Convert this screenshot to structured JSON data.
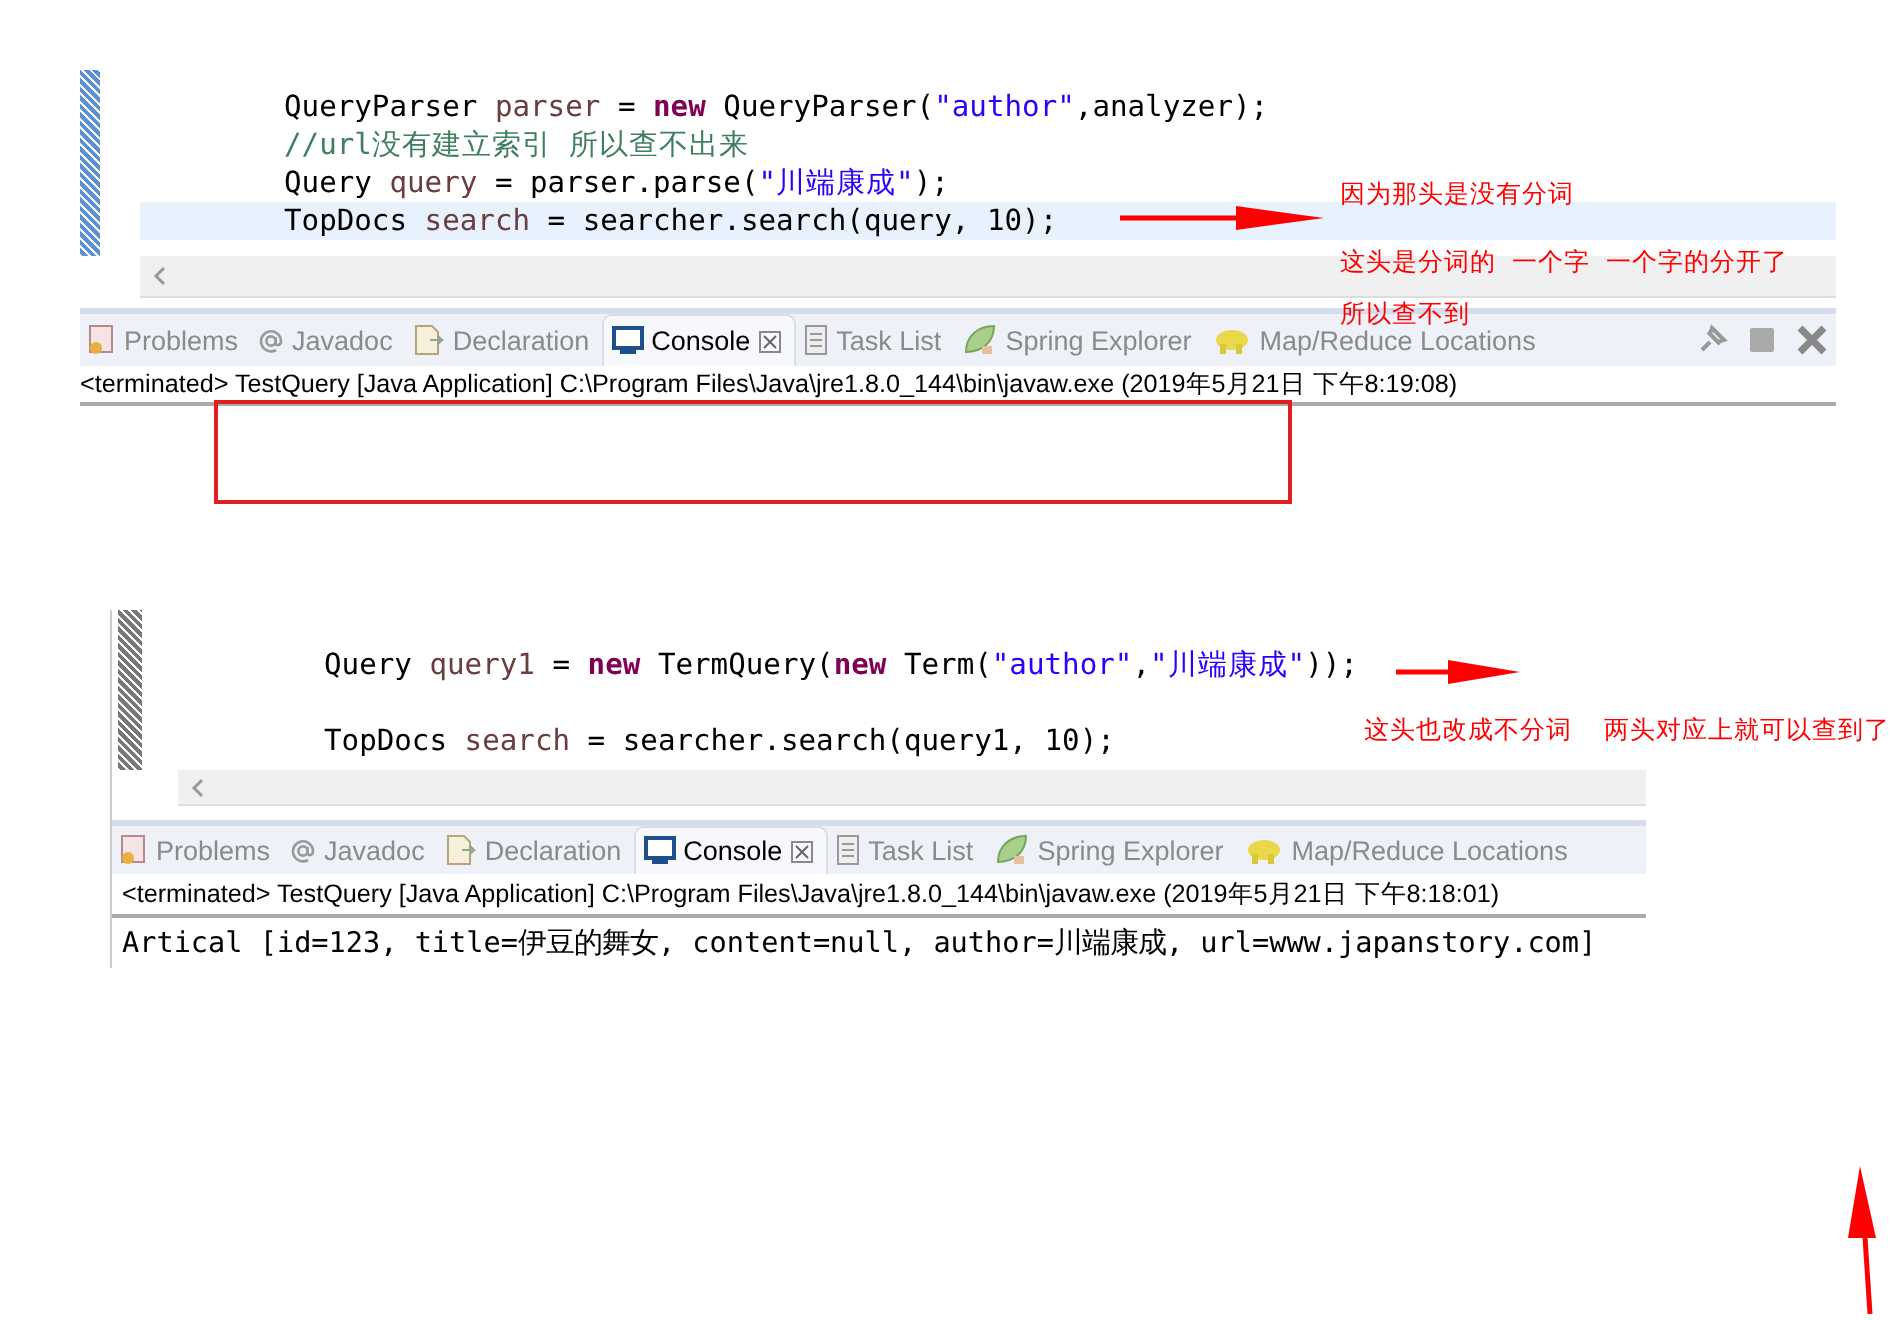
{
  "panels": [
    {
      "code_lines": [
        {
          "highlighted": false,
          "tokens": [
            {
              "kind": "type",
              "text": "QueryParser "
            },
            {
              "kind": "var",
              "text": "parser"
            },
            {
              "kind": "plain",
              "text": " = "
            },
            {
              "kind": "keyword",
              "text": "new"
            },
            {
              "kind": "plain",
              "text": " QueryParser("
            },
            {
              "kind": "string",
              "text": "\"author\""
            },
            {
              "kind": "plain",
              "text": ",analyzer);"
            }
          ]
        },
        {
          "highlighted": false,
          "tokens": [
            {
              "kind": "comment",
              "text": "//url没有建立索引 所以查不出来"
            }
          ]
        },
        {
          "highlighted": false,
          "tokens": [
            {
              "kind": "type",
              "text": "Query "
            },
            {
              "kind": "var",
              "text": "query"
            },
            {
              "kind": "plain",
              "text": " = parser.parse("
            },
            {
              "kind": "string",
              "text": "\"川端康成\""
            },
            {
              "kind": "plain",
              "text": ");"
            }
          ]
        },
        {
          "highlighted": true,
          "tokens": [
            {
              "kind": "type",
              "text": "TopDocs "
            },
            {
              "kind": "var",
              "text": "search"
            },
            {
              "kind": "plain",
              "text": " = searcher.search(query, 10);"
            }
          ]
        }
      ],
      "tabs": [
        {
          "label": "Problems",
          "selected": false
        },
        {
          "label": "Javadoc",
          "selected": false
        },
        {
          "label": "Declaration",
          "selected": false
        },
        {
          "label": "Console",
          "selected": true
        },
        {
          "label": "Task List",
          "selected": false
        },
        {
          "label": "Spring Explorer",
          "selected": false
        },
        {
          "label": "Map/Reduce Locations",
          "selected": false
        }
      ],
      "view_actions": [
        {
          "kind": "pin"
        },
        {
          "kind": "terminate"
        },
        {
          "kind": "remove"
        }
      ],
      "console_header": "<terminated> TestQuery [Java Application] C:\\Program Files\\Java\\jre1.8.0_144\\bin\\javaw.exe (2019年5月21日 下午8:19:08)",
      "notes": [
        "因为那头是没有分词",
        "这头是分词的  一个字  一个字的分开了",
        "所以查不到"
      ]
    },
    {
      "code_lines": [
        {
          "highlighted": false,
          "tokens": [
            {
              "kind": "type",
              "text": "Query "
            },
            {
              "kind": "var",
              "text": "query1"
            },
            {
              "kind": "plain",
              "text": " = "
            },
            {
              "kind": "keyword",
              "text": "new"
            },
            {
              "kind": "plain",
              "text": " TermQuery("
            },
            {
              "kind": "keyword",
              "text": "new"
            },
            {
              "kind": "plain",
              "text": " Term("
            },
            {
              "kind": "string",
              "text": "\"author\""
            },
            {
              "kind": "plain",
              "text": ","
            },
            {
              "kind": "string",
              "text": "\"川端康成\""
            },
            {
              "kind": "plain",
              "text": "));"
            }
          ]
        },
        {
          "highlighted": false,
          "tokens": [
            {
              "kind": "type",
              "text": "TopDocs "
            },
            {
              "kind": "var",
              "text": "search"
            },
            {
              "kind": "plain",
              "text": " = searcher.search(query1, 10);"
            }
          ]
        }
      ],
      "tabs": [
        {
          "label": "Problems",
          "selected": false
        },
        {
          "label": "Javadoc",
          "selected": false
        },
        {
          "label": "Declaration",
          "selected": false
        },
        {
          "label": "Console",
          "selected": true
        },
        {
          "label": "Task List",
          "selected": false
        },
        {
          "label": "Spring Explorer",
          "selected": false
        },
        {
          "label": "Map/Reduce Locations",
          "selected": false
        }
      ],
      "console_header": "<terminated> TestQuery [Java Application] C:\\Program Files\\Java\\jre1.8.0_144\\bin\\javaw.exe (2019年5月21日 下午8:18:01)",
      "console_output": "Artical [id=123, title=伊豆的舞女, content=null, author=川端康成, url=www.japanstory.com]",
      "notes": [
        "这头也改成不分词    两头对应上就可以查到了"
      ]
    }
  ]
}
